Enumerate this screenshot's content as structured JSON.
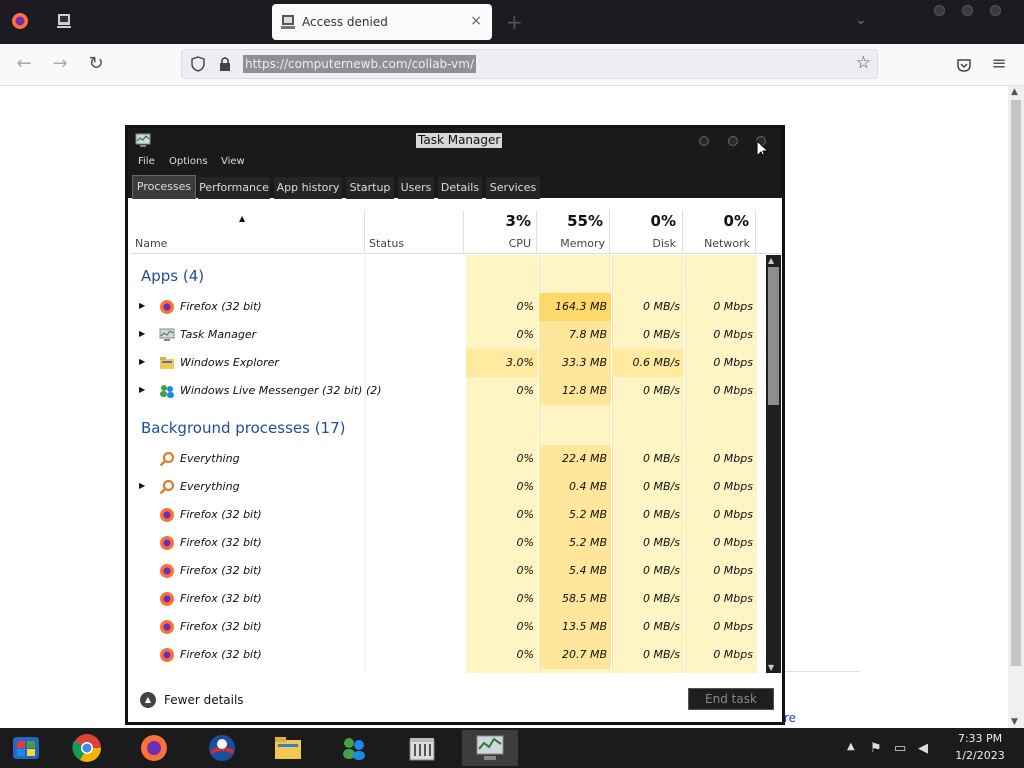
{
  "browser": {
    "tab_title": "Access denied",
    "tab_close": "×",
    "new_tab": "+",
    "url": "https://computernewb.com/collab-vm/",
    "back": "←",
    "forward": "→",
    "reload": "↻",
    "star": "☆",
    "menu": "≡"
  },
  "task_manager": {
    "title": "Task Manager",
    "menu": [
      "File",
      "Options",
      "View"
    ],
    "tabs": [
      "Processes",
      "Performance",
      "App history",
      "Startup",
      "Users",
      "Details",
      "Services"
    ],
    "columns": {
      "name": "Name",
      "status": "Status",
      "cpu_pct": "3%",
      "cpu": "CPU",
      "mem_pct": "55%",
      "mem": "Memory",
      "disk_pct": "0%",
      "disk": "Disk",
      "net_pct": "0%",
      "net": "Network"
    },
    "groups": {
      "apps": "Apps (4)",
      "background": "Background processes (17)"
    },
    "apps": [
      {
        "name": "Firefox (32 bit)",
        "cpu": "0%",
        "mem": "164.3 MB",
        "disk": "0 MB/s",
        "net": "0 Mbps",
        "icon": "firefox-icon"
      },
      {
        "name": "Task Manager",
        "cpu": "0%",
        "mem": "7.8 MB",
        "disk": "0 MB/s",
        "net": "0 Mbps",
        "icon": "task-manager-icon"
      },
      {
        "name": "Windows Explorer",
        "cpu": "3.0%",
        "mem": "33.3 MB",
        "disk": "0.6 MB/s",
        "net": "0 Mbps",
        "icon": "folder-icon"
      },
      {
        "name": "Windows Live Messenger (32 bit) (2)",
        "cpu": "0%",
        "mem": "12.8 MB",
        "disk": "0 MB/s",
        "net": "0 Mbps",
        "icon": "messenger-icon"
      }
    ],
    "background": [
      {
        "name": "Everything",
        "cpu": "0%",
        "mem": "22.4 MB",
        "disk": "0 MB/s",
        "net": "0 Mbps",
        "icon": "everything-icon"
      },
      {
        "name": "Everything",
        "cpu": "0%",
        "mem": "0.4 MB",
        "disk": "0 MB/s",
        "net": "0 Mbps",
        "icon": "everything-icon"
      },
      {
        "name": "Firefox (32 bit)",
        "cpu": "0%",
        "mem": "5.2 MB",
        "disk": "0 MB/s",
        "net": "0 Mbps",
        "icon": "firefox-icon"
      },
      {
        "name": "Firefox (32 bit)",
        "cpu": "0%",
        "mem": "5.2 MB",
        "disk": "0 MB/s",
        "net": "0 Mbps",
        "icon": "firefox-icon"
      },
      {
        "name": "Firefox (32 bit)",
        "cpu": "0%",
        "mem": "5.4 MB",
        "disk": "0 MB/s",
        "net": "0 Mbps",
        "icon": "firefox-icon"
      },
      {
        "name": "Firefox (32 bit)",
        "cpu": "0%",
        "mem": "58.5 MB",
        "disk": "0 MB/s",
        "net": "0 Mbps",
        "icon": "firefox-icon"
      },
      {
        "name": "Firefox (32 bit)",
        "cpu": "0%",
        "mem": "13.5 MB",
        "disk": "0 MB/s",
        "net": "0 Mbps",
        "icon": "firefox-icon"
      },
      {
        "name": "Firefox (32 bit)",
        "cpu": "0%",
        "mem": "20.7 MB",
        "disk": "0 MB/s",
        "net": "0 Mbps",
        "icon": "firefox-icon"
      }
    ],
    "fewer_details": "Fewer details",
    "end_task": "End task"
  },
  "page": {
    "partial_link": "re"
  },
  "taskbar": {
    "time": "7:33 PM",
    "date": "1/2/2023"
  }
}
